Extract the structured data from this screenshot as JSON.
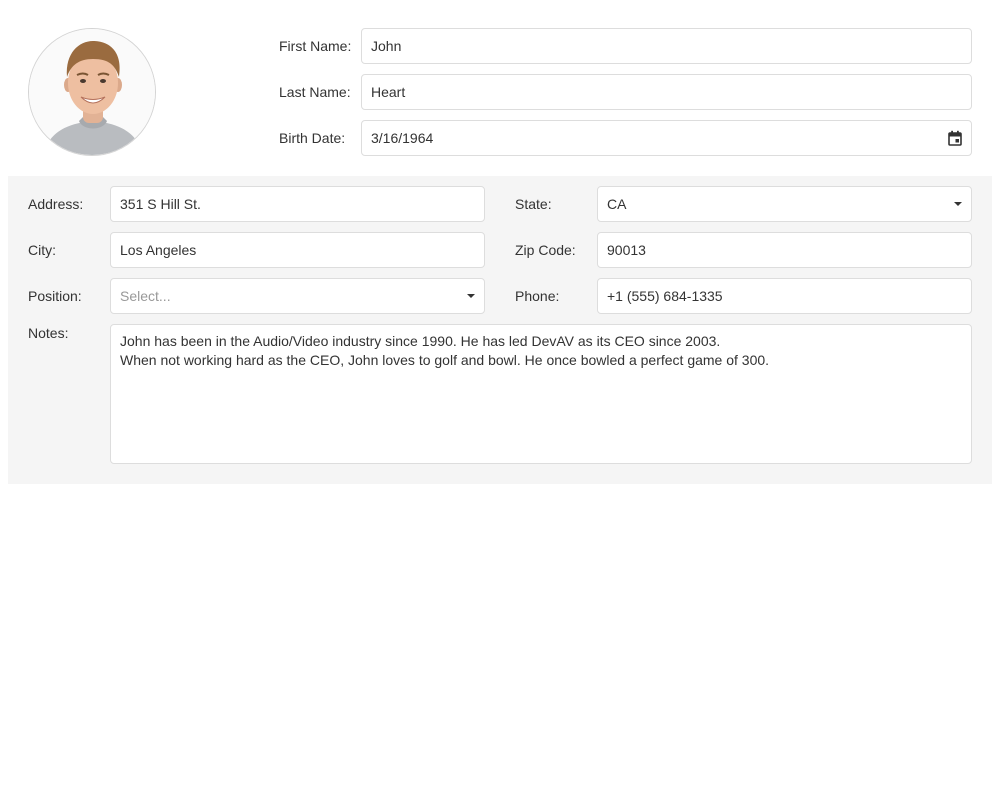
{
  "avatar": {
    "icon": "person-photo"
  },
  "header": {
    "first_name": {
      "label": "First Name:",
      "value": "John"
    },
    "last_name": {
      "label": "Last Name:",
      "value": "Heart"
    },
    "birth_date": {
      "label": "Birth Date:",
      "value": "3/16/1964",
      "icon": "calendar-icon"
    }
  },
  "details": {
    "address": {
      "label": "Address:",
      "value": "351 S Hill St."
    },
    "city": {
      "label": "City:",
      "value": "Los Angeles"
    },
    "position": {
      "label": "Position:",
      "placeholder": "Select...",
      "icon": "chevron-down-icon"
    },
    "state": {
      "label": "State:",
      "value": "CA",
      "icon": "chevron-down-icon"
    },
    "zip": {
      "label": "Zip Code:",
      "value": "90013"
    },
    "phone": {
      "label": "Phone:",
      "value": "+1 (555) 684-1335"
    },
    "notes": {
      "label": "Notes:",
      "lines": [
        "John has been in the Audio/Video industry since 1990. He has led DevAV as its CEO since 2003.",
        "When not working hard as the CEO, John loves to golf and bowl. He once bowled a perfect game of 300."
      ]
    }
  },
  "colors": {
    "panel_background": "#f5f5f5",
    "field_border": "#dddddd",
    "text": "#333333",
    "placeholder": "#999999"
  }
}
